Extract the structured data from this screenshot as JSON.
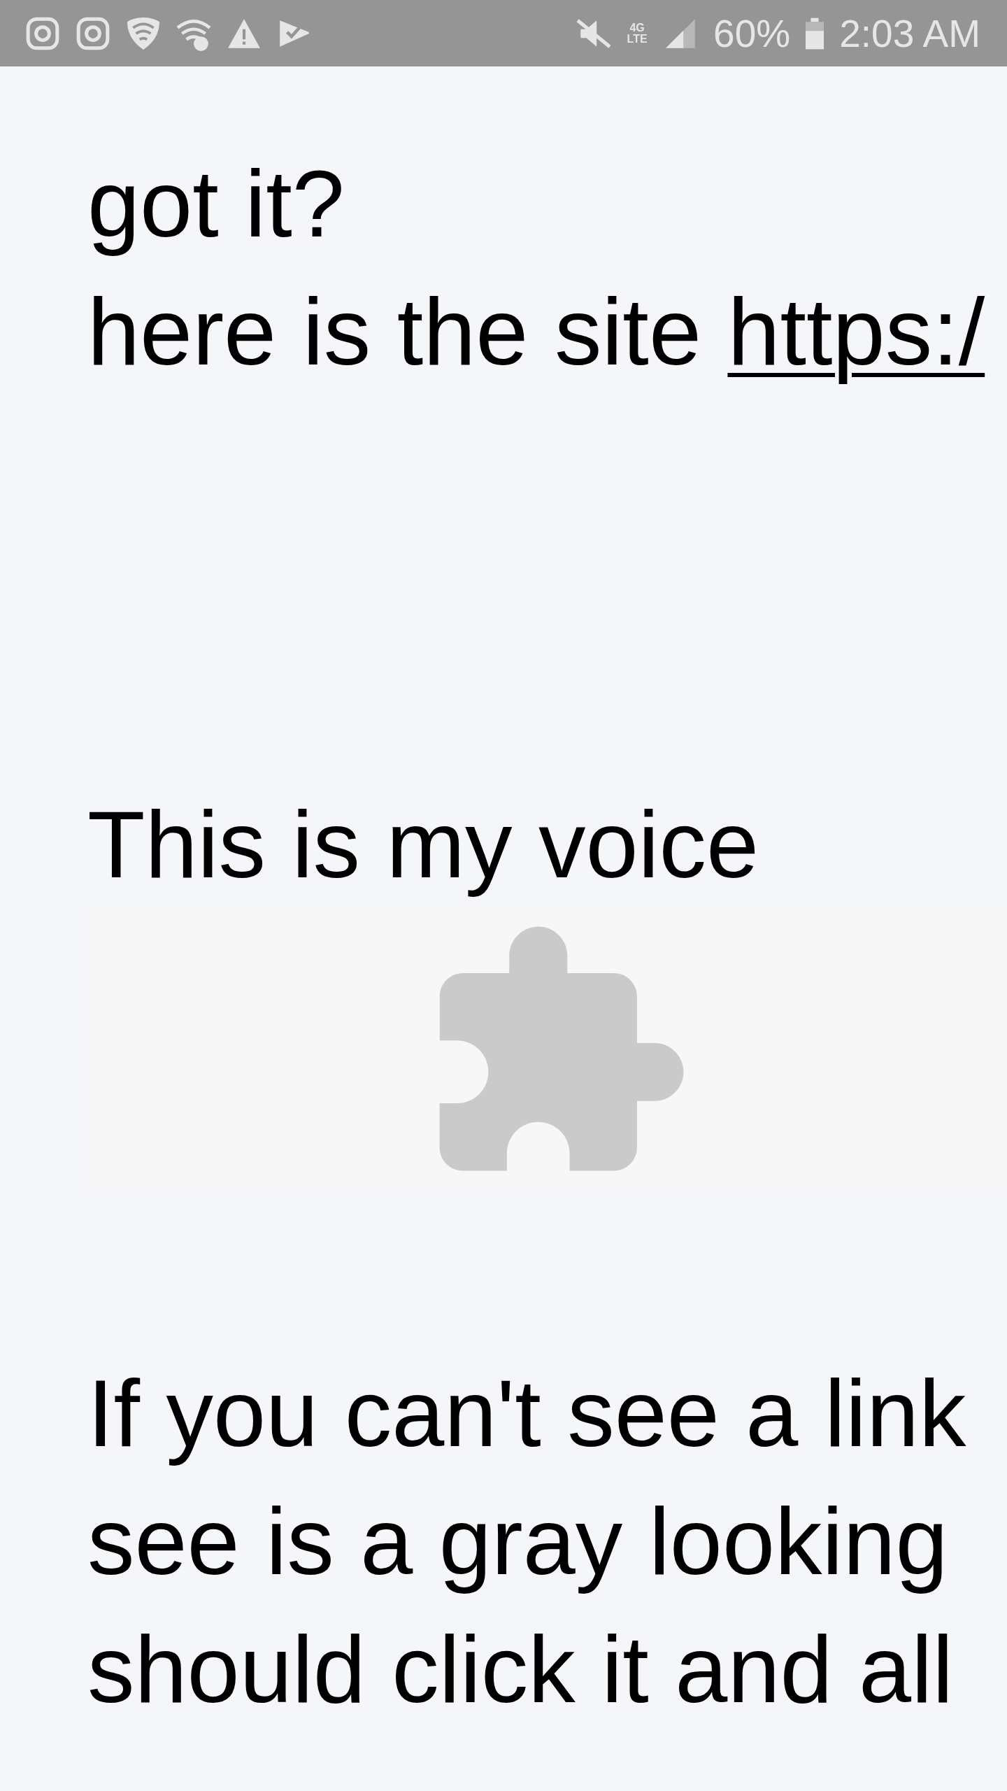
{
  "status_bar": {
    "network": "4G LTE",
    "battery": "60%",
    "time": "2:03 AM"
  },
  "blocks": [
    {
      "kind": "text",
      "lines": [
        {
          "text": "got it?"
        },
        {
          "text": "here is the site ",
          "link": "https:/"
        }
      ]
    },
    {
      "kind": "text",
      "lines": [
        {
          "text": "This is my voice"
        }
      ]
    },
    {
      "kind": "plugin"
    },
    {
      "kind": "text",
      "lines": [
        {
          "text": "If you can't see a link"
        },
        {
          "text": "see is a gray looking"
        },
        {
          "text": "should click it and all"
        }
      ]
    }
  ]
}
